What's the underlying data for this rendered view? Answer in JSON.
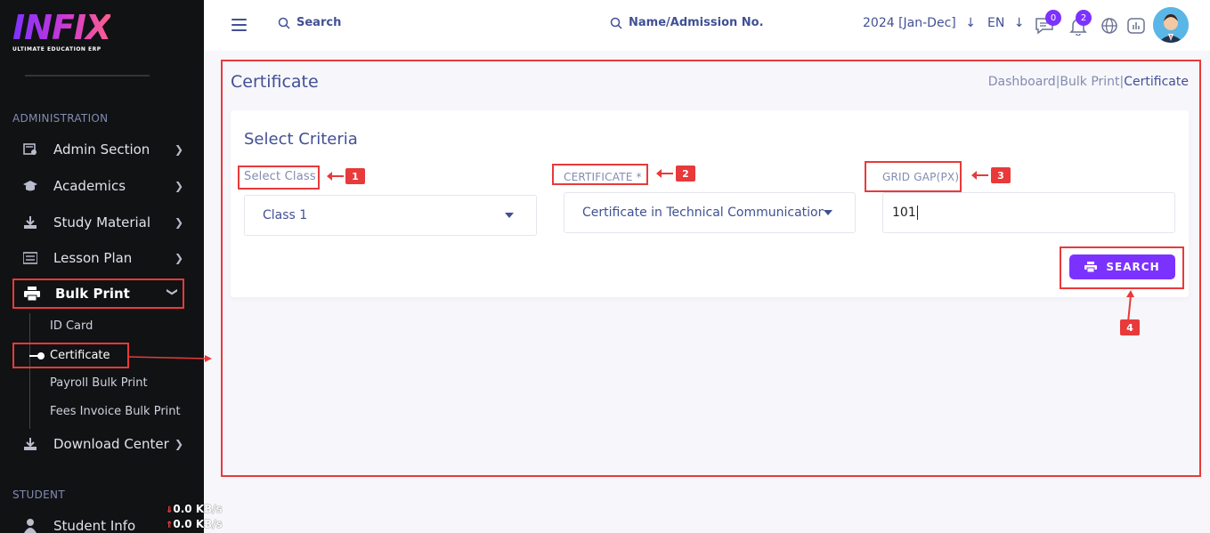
{
  "brand": {
    "name": "INFIX",
    "tagline": "ULTIMATE EDUCATION ERP"
  },
  "sidebar": {
    "section_admin": "ADMINISTRATION",
    "section_student": "STUDENT",
    "items": [
      {
        "label": "Admin Section",
        "icon": "admin-icon"
      },
      {
        "label": "Academics",
        "icon": "graduation-cap-icon"
      },
      {
        "label": "Study Material",
        "icon": "download-icon"
      },
      {
        "label": "Lesson Plan",
        "icon": "list-icon"
      },
      {
        "label": "Bulk Print",
        "icon": "printer-icon"
      },
      {
        "label": "Download Center",
        "icon": "download-icon"
      },
      {
        "label": "Student Info",
        "icon": "user-icon"
      }
    ],
    "bulk_print_sub": [
      "ID Card",
      "Certificate",
      "Payroll Bulk Print",
      "Fees Invoice Bulk Print"
    ]
  },
  "network": {
    "down": "0.0 KB/s",
    "up": "0.0 KB/s"
  },
  "topbar": {
    "search_label": "Search",
    "student_search_label": "Name/Admission No.",
    "academic_year": "2024 [Jan-Dec]",
    "language": "EN",
    "messages_count": "0",
    "notifications_count": "2"
  },
  "page": {
    "title": "Certificate",
    "breadcrumbs": [
      "Dashboard",
      "Bulk Print",
      "Certificate"
    ]
  },
  "form": {
    "title": "Select Criteria",
    "class_label": "Select Class",
    "class_value": "Class 1",
    "certificate_label": "CERTIFICATE *",
    "certificate_value": "Certificate in Technical Communication (",
    "grid_gap_label": "GRID GAP(PX)",
    "grid_gap_value": "101",
    "search_button": "SEARCH"
  },
  "annotations": [
    "1",
    "2",
    "3",
    "4"
  ],
  "colors": {
    "accent": "#7c32ff",
    "highlight": "#e83a3a",
    "sidebar_bg": "#111214",
    "text": "#415094"
  }
}
